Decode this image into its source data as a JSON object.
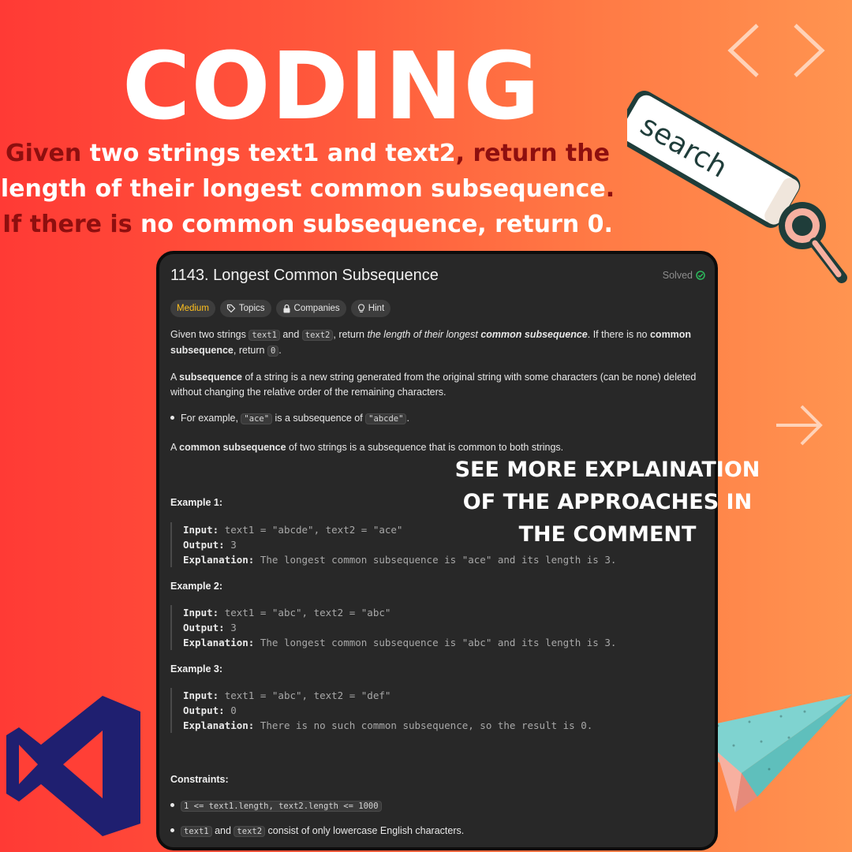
{
  "hero": {
    "title": "CODING",
    "question_parts": [
      {
        "text": "Given",
        "dark": true
      },
      {
        "text": " two strings text1 and text2",
        "dark": false
      },
      {
        "text": ", return the",
        "dark": true
      },
      {
        "text": " length of their longest common subsequence",
        "dark": false
      },
      {
        "text": ". If there is",
        "dark": true
      },
      {
        "text": " no common subsequence, return 0.",
        "dark": false
      }
    ]
  },
  "decorations": {
    "search_label": "search",
    "chevrons_icon": "code-brackets-icon",
    "arrow_icon": "arrow-right-icon",
    "logo_icon": "visual-studio-logo",
    "plane_icon": "paper-plane-icon"
  },
  "problem": {
    "title": "1143. Longest Common Subsequence",
    "status": "Solved",
    "tags": [
      {
        "label": "Medium",
        "icon": ""
      },
      {
        "label": "Topics",
        "icon": "tag-icon"
      },
      {
        "label": "Companies",
        "icon": "lock-icon"
      },
      {
        "label": "Hint",
        "icon": "lightbulb-icon"
      }
    ],
    "desc1": {
      "a": "Given two strings ",
      "code1": "text1",
      "b": " and ",
      "code2": "text2",
      "c": ", return ",
      "italic": "the length of their longest ",
      "bold_italic": "common subsequence",
      "d": ". If there is no ",
      "bold1": "common subsequence",
      "e": ", return ",
      "code3": "0",
      "f": "."
    },
    "desc2": {
      "a": "A ",
      "bold": "subsequence",
      "b": " of a string is a new string generated from the original string with some characters (can be none) deleted without changing the relative order of the remaining characters."
    },
    "bullet1": {
      "a": "For example, ",
      "code1": "\"ace\"",
      "b": " is a subsequence of ",
      "code2": "\"abcde\"",
      "c": "."
    },
    "desc3": {
      "a": "A ",
      "bold": "common subsequence",
      "b": " of two strings is a subsequence that is common to both strings."
    },
    "examples": [
      {
        "title": "Example 1:",
        "input_label": "Input:",
        "input": "text1 = \"abcde\", text2 = \"ace\"",
        "output_label": "Output:",
        "output": "3",
        "explanation_label": "Explanation:",
        "explanation": "The longest common subsequence is \"ace\" and its length is 3."
      },
      {
        "title": "Example 2:",
        "input_label": "Input:",
        "input": "text1 = \"abc\", text2 = \"abc\"",
        "output_label": "Output:",
        "output": "3",
        "explanation_label": "Explanation:",
        "explanation": "The longest common subsequence is \"abc\" and its length is 3."
      },
      {
        "title": "Example 3:",
        "input_label": "Input:",
        "input": "text1 = \"abc\", text2 = \"def\"",
        "output_label": "Output:",
        "output": "0",
        "explanation_label": "Explanation:",
        "explanation": "There is no such common subsequence, so the result is 0."
      }
    ],
    "constraints_title": "Constraints:",
    "constraint1": "1 <= text1.length, text2.length <= 1000",
    "constraint2": {
      "code1": "text1",
      "a": " and ",
      "code2": "text2",
      "b": " consist of only lowercase English characters."
    }
  },
  "overlay_note": "SEE MORE EXPLAINATION OF THE APPROACHES IN THE COMMENT",
  "colors": {
    "bg_left": "#ff3a35",
    "bg_right": "#ff9450",
    "accent_dark": "#8e0f0f",
    "panel_bg": "#282828",
    "medium": "#ffc01e",
    "solved_check": "#2cbb5d"
  }
}
